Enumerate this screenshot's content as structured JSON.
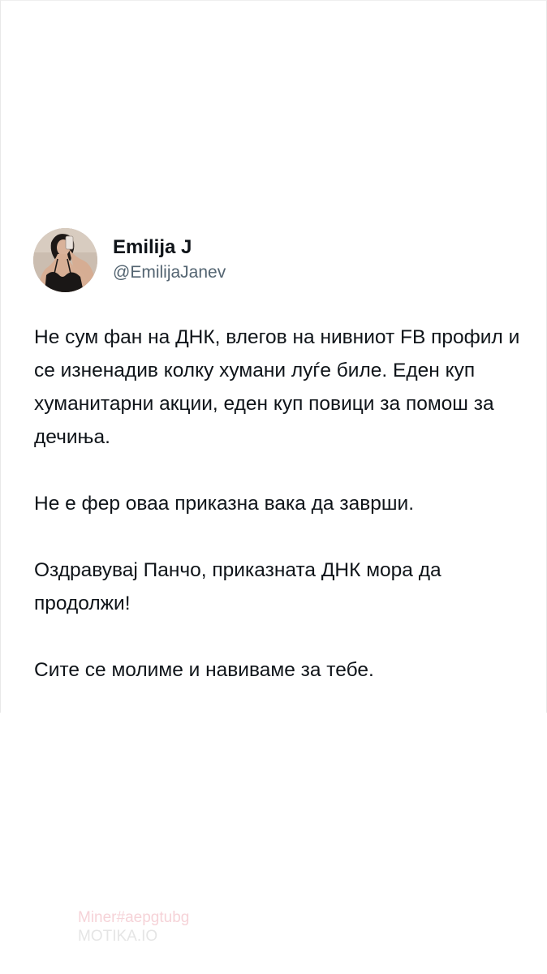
{
  "tweet": {
    "display_name": "Emilija J",
    "handle": "@EmilijaJanev",
    "avatar_icon": "profile-photo",
    "paragraphs": [
      "Не сум фан на ДНК, влегов на нивниот FB профил и се изненадив колку хумани луѓе биле. Еден куп хуманитарни акции, еден куп повици за помош за дечиња.",
      "Не е фер оваа приказна вака да заврши.",
      "Оздравувај Панчо, приказната ДНК мора да продолжи!",
      "Сите се молиме и навиваме за тебе."
    ]
  },
  "watermark": {
    "line1": "Miner#aepgtubg",
    "line2": "MOTIKA.IO"
  },
  "colors": {
    "text": "#0f1419",
    "handle": "#536471",
    "background": "#ffffff"
  }
}
